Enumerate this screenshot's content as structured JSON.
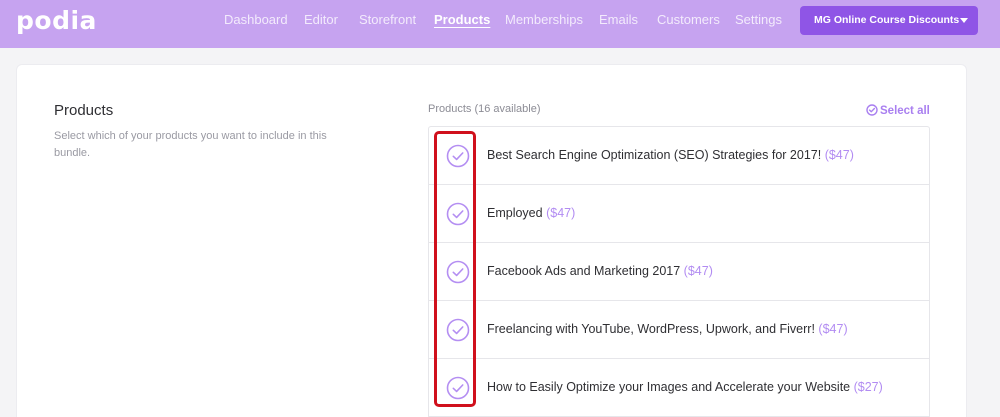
{
  "app": {
    "logo": "podia"
  },
  "nav": {
    "items": [
      {
        "label": "Dashboard"
      },
      {
        "label": "Editor"
      },
      {
        "label": "Storefront"
      },
      {
        "label": "Products",
        "active": true
      },
      {
        "label": "Memberships"
      },
      {
        "label": "Emails"
      },
      {
        "label": "Customers"
      },
      {
        "label": "Settings"
      }
    ],
    "account_label": "MG Online Course Discounts"
  },
  "products_section": {
    "title": "Products",
    "description": "Select which of your products you want to include in this bundle.",
    "available_label": "Products (16 available)",
    "select_all_label": "Select all",
    "items": [
      {
        "name": "Best Search Engine Optimization (SEO) Strategies for 2017!",
        "price": "($47)",
        "selected": true
      },
      {
        "name": "Employed",
        "price": "($47)",
        "selected": true
      },
      {
        "name": "Facebook Ads and Marketing 2017",
        "price": "($47)",
        "selected": true
      },
      {
        "name": "Freelancing with YouTube, WordPress, Upwork, and Fiverr!",
        "price": "($47)",
        "selected": true
      },
      {
        "name": "How to Easily Optimize your Images and Accelerate your Website",
        "price": "($27)",
        "selected": true
      }
    ]
  },
  "colors": {
    "topbar": "#c6a3f0",
    "account_button": "#8f55e6",
    "accent": "#a97ff0",
    "highlight": "#d0101c"
  },
  "icons": {
    "check": "check-circle-icon",
    "caret": "caret-down-icon"
  }
}
